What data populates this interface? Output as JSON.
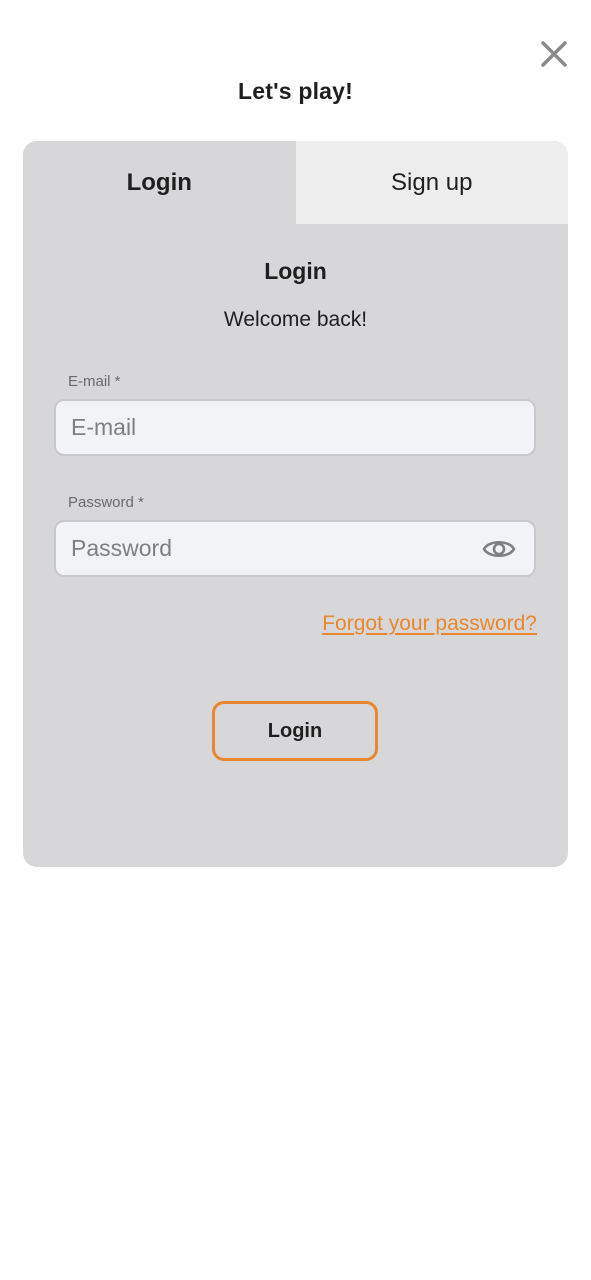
{
  "modal": {
    "title": "Let's play!",
    "close_icon": "close-icon"
  },
  "tabs": [
    {
      "label": "Login",
      "active": true
    },
    {
      "label": "Sign up",
      "active": false
    }
  ],
  "form": {
    "heading": "Login",
    "subtitle": "Welcome back!",
    "email": {
      "label": "E-mail *",
      "placeholder": "E-mail",
      "value": ""
    },
    "password": {
      "label": "Password *",
      "placeholder": "Password",
      "value": "",
      "toggle_icon": "eye-icon"
    },
    "forgot_link": "Forgot your password?",
    "submit_label": "Login"
  },
  "colors": {
    "accent": "#e8872e",
    "card_bg": "#d7d7d9",
    "inactive_tab_bg": "#ededee",
    "input_bg": "#f1f3f6"
  }
}
